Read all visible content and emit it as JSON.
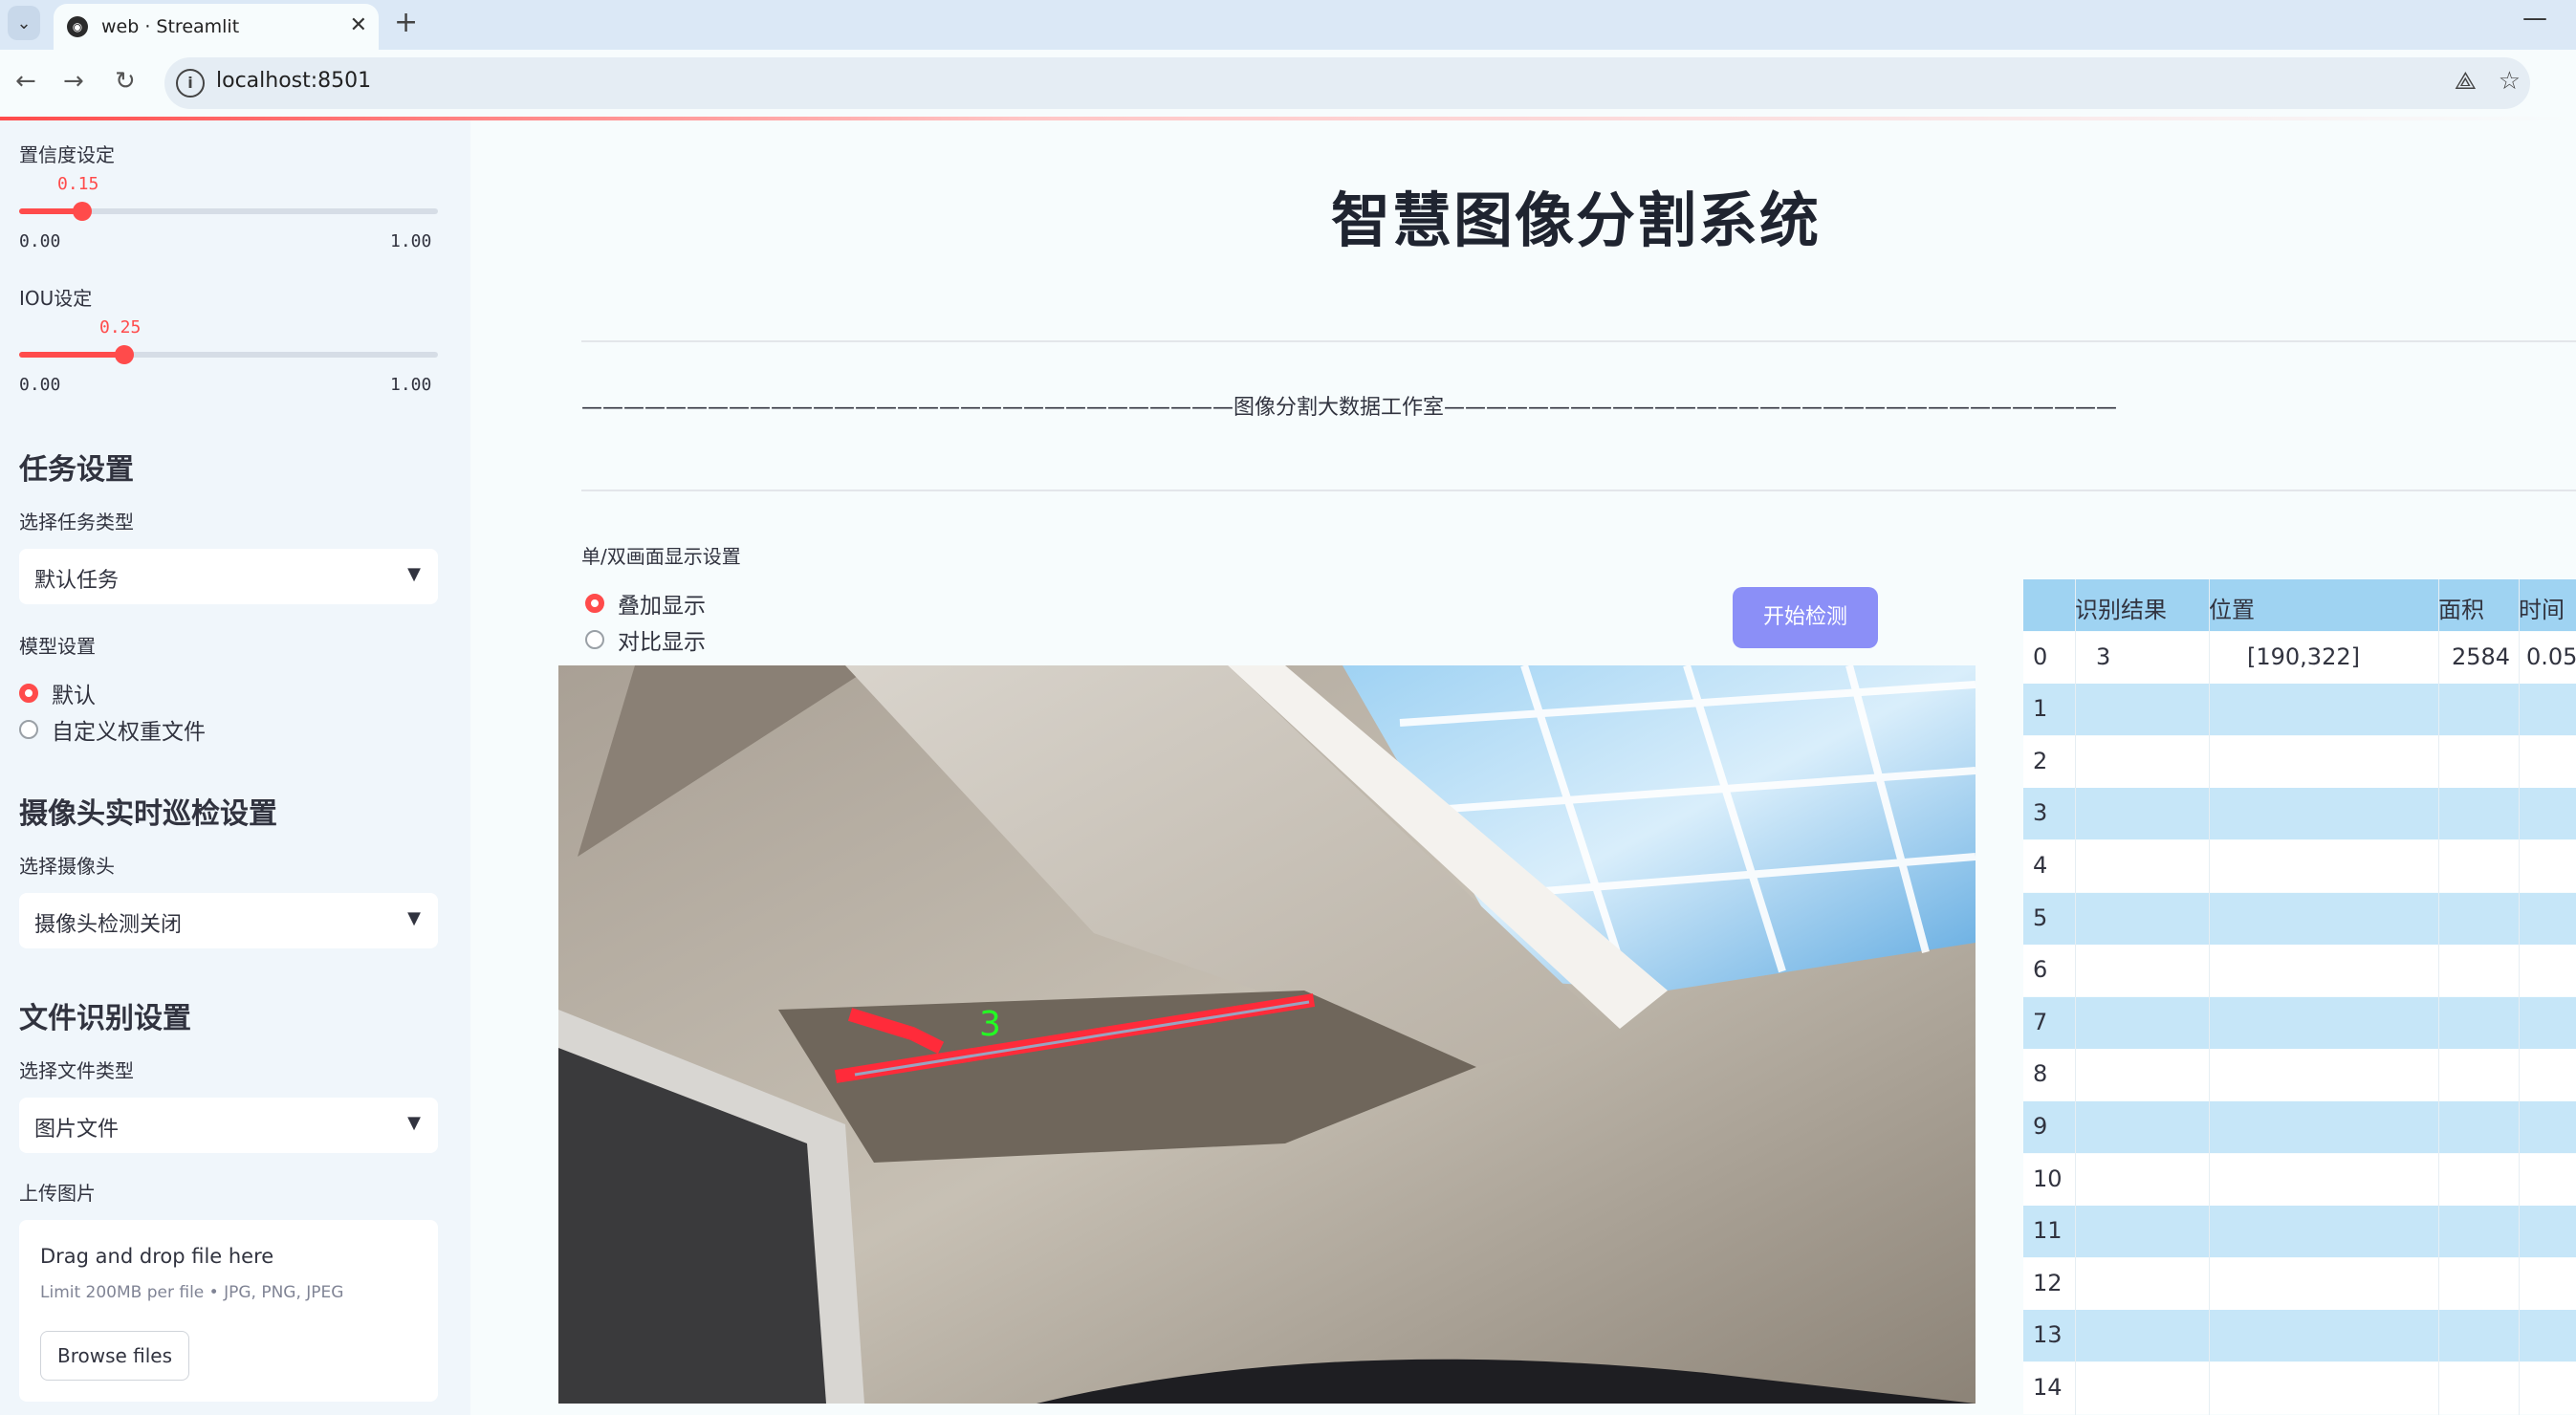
{
  "browser": {
    "tab_title": "web · Streamlit",
    "url": "localhost:8501"
  },
  "sidebar": {
    "confidence": {
      "label": "置信度设定",
      "value": "0.15",
      "min": "0.00",
      "max": "1.00",
      "fraction": 0.15
    },
    "iou": {
      "label": "IOU设定",
      "value": "0.25",
      "min": "0.00",
      "max": "1.00",
      "fraction": 0.25
    },
    "task_header": "任务设置",
    "task_type_label": "选择任务类型",
    "task_type_value": "默认任务",
    "model_label": "模型设置",
    "model_options": [
      "默认",
      "自定义权重文件"
    ],
    "camera_header": "摄像头实时巡检设置",
    "camera_label": "选择摄像头",
    "camera_value": "摄像头检测关闭",
    "file_header": "文件识别设置",
    "file_type_label": "选择文件类型",
    "file_type_value": "图片文件",
    "upload_label": "上传图片",
    "upload_drag": "Drag and drop file here",
    "upload_limit": "Limit 200MB per file • JPG, PNG, JPEG",
    "upload_button": "Browse files"
  },
  "main": {
    "title": "智慧图像分割系统",
    "banner": "———————————————————————————————图像分割大数据工作室————————————————————————————————",
    "display_mode_label": "单/双画面显示设置",
    "display_options": [
      "叠加显示",
      "对比显示"
    ],
    "start_button": "开始检测",
    "detection_label": "3"
  },
  "table": {
    "headers": [
      "",
      "识别结果",
      "位置",
      "面积",
      "时间"
    ],
    "rows": [
      [
        "0",
        "3",
        "[190,322]",
        "2584",
        "0.05"
      ],
      [
        "1",
        "",
        "",
        "",
        ""
      ],
      [
        "2",
        "",
        "",
        "",
        ""
      ],
      [
        "3",
        "",
        "",
        "",
        ""
      ],
      [
        "4",
        "",
        "",
        "",
        ""
      ],
      [
        "5",
        "",
        "",
        "",
        ""
      ],
      [
        "6",
        "",
        "",
        "",
        ""
      ],
      [
        "7",
        "",
        "",
        "",
        ""
      ],
      [
        "8",
        "",
        "",
        "",
        ""
      ],
      [
        "9",
        "",
        "",
        "",
        ""
      ],
      [
        "10",
        "",
        "",
        "",
        ""
      ],
      [
        "11",
        "",
        "",
        "",
        ""
      ],
      [
        "12",
        "",
        "",
        "",
        ""
      ],
      [
        "13",
        "",
        "",
        "",
        ""
      ],
      [
        "14",
        "",
        "",
        "",
        ""
      ]
    ]
  },
  "colors": {
    "accent": "#ff4b4b",
    "button": "#8b8ff7",
    "table_header": "#9fd3f2",
    "table_stripe": "#c6e6f8"
  }
}
